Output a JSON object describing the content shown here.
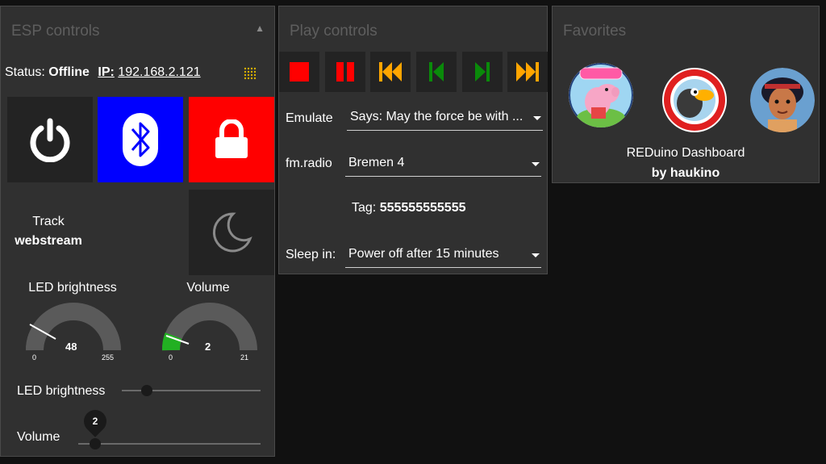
{
  "esp": {
    "title": "ESP controls",
    "status_label": "Status:",
    "status_value": "Offline",
    "ip_label": "IP:",
    "ip_value": "192.168.2.121",
    "track_label": "Track",
    "track_value": "webstream",
    "led_gauge": {
      "label": "LED brightness",
      "value": "48",
      "min": "0",
      "max": "255"
    },
    "volume_gauge": {
      "label": "Volume",
      "value": "2",
      "min": "0",
      "max": "21"
    },
    "led_slider": {
      "label": "LED brightness",
      "value": 48,
      "max": 255
    },
    "volume_slider": {
      "label": "Volume",
      "value": "2",
      "max": 21
    }
  },
  "play": {
    "title": "Play controls",
    "emulate_label": "Emulate",
    "emulate_value": "Says: May the force be with ...",
    "radio_label": "fm.radio",
    "radio_value": "Bremen 4",
    "tag_label": "Tag:",
    "tag_value": "555555555555",
    "sleep_label": "Sleep in:",
    "sleep_value": "Power off after 15 minutes"
  },
  "favorites": {
    "title": "Favorites",
    "caption": "REDuino Dashboard",
    "author": "by haukino",
    "avatar1_text": "Peppa Pig"
  },
  "colors": {
    "red": "#ff0000",
    "bluetooth": "#0000ff",
    "orange": "#ffa500",
    "green": "#0a8a0a"
  }
}
